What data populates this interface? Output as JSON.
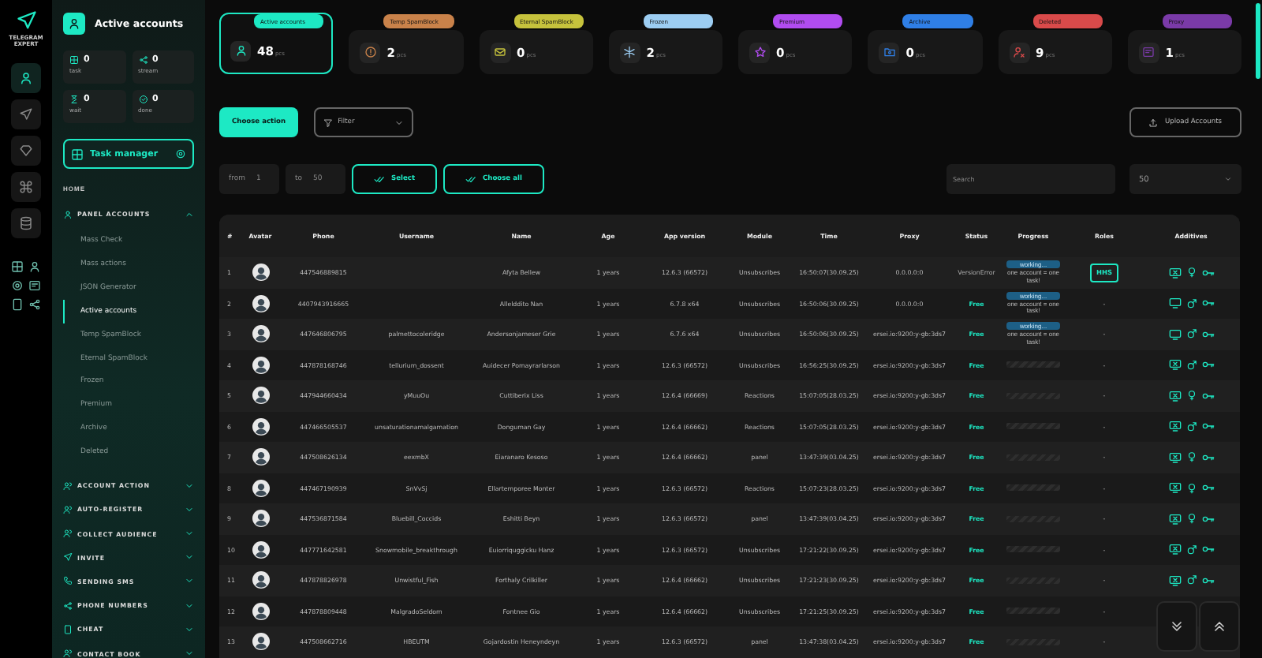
{
  "app": {
    "logo_text": "TELEGRAM EXPERT"
  },
  "rail": [
    {
      "kind": "user",
      "selected": true
    },
    {
      "kind": "send",
      "selected": false
    },
    {
      "kind": "diamond",
      "selected": false
    },
    {
      "kind": "command",
      "selected": false
    },
    {
      "kind": "database",
      "selected": false
    }
  ],
  "sidebar": {
    "title": "Active accounts",
    "stats": [
      {
        "kind": "task",
        "value": "0",
        "label": "task"
      },
      {
        "kind": "stream",
        "value": "0",
        "label": "stream"
      },
      {
        "kind": "wait",
        "value": "0",
        "label": "wait"
      },
      {
        "kind": "done",
        "value": "0",
        "label": "done"
      }
    ],
    "task_manager": "Task manager",
    "nav": [
      {
        "kind": "link",
        "label": "HOME"
      },
      {
        "kind": "group",
        "label": "PANEL ACCOUNTS",
        "expanded": true,
        "children": [
          {
            "label": "Mass Check",
            "selected": false
          },
          {
            "label": "Mass actions",
            "selected": false
          },
          {
            "label": "JSON Generator",
            "selected": false
          },
          {
            "label": "Active accounts",
            "selected": true
          },
          {
            "label": "Temp SpamBlock",
            "selected": false
          },
          {
            "label": "Eternal SpamBlock",
            "selected": false
          },
          {
            "label": "Frozen",
            "selected": false
          },
          {
            "label": "Premium",
            "selected": false
          },
          {
            "label": "Archive",
            "selected": false
          },
          {
            "label": "Deleted",
            "selected": false
          }
        ]
      },
      {
        "kind": "group",
        "label": "ACCOUNT ACTION",
        "expanded": false
      },
      {
        "kind": "group",
        "label": "AUTO-REGISTER",
        "expanded": false
      },
      {
        "kind": "group",
        "label": "COLLECT AUDIENCE",
        "expanded": false
      },
      {
        "kind": "group",
        "label": "INVITE",
        "expanded": false
      },
      {
        "kind": "group",
        "label": "SENDING SMS",
        "expanded": false
      },
      {
        "kind": "group",
        "label": "PHONE NUMBERS",
        "expanded": false
      },
      {
        "kind": "group",
        "label": "CHEAT",
        "expanded": false
      },
      {
        "kind": "group",
        "label": "CONTACT BOOK",
        "expanded": false
      }
    ]
  },
  "cards": [
    {
      "kind": "active",
      "label": "Active accounts",
      "count": "48",
      "unit": "pcs",
      "color": "#1de9c4",
      "selected": true
    },
    {
      "kind": "temp",
      "label": "Temp SpamBlock",
      "count": "2",
      "unit": "pcs",
      "color": "#c9824a",
      "selected": false
    },
    {
      "kind": "eternal",
      "label": "Eternal SpamBlock",
      "count": "0",
      "unit": "pcs",
      "color": "#c6c23c",
      "selected": false
    },
    {
      "kind": "frozen",
      "label": "Frozen",
      "count": "2",
      "unit": "pcs",
      "color": "#9ccdf2",
      "selected": false
    },
    {
      "kind": "premium",
      "label": "Premium",
      "count": "0",
      "unit": "pcs",
      "color": "#b14cf0",
      "selected": false
    },
    {
      "kind": "archive",
      "label": "Archive",
      "count": "0",
      "unit": "pcs",
      "color": "#2f7fe6",
      "selected": false
    },
    {
      "kind": "deleted",
      "label": "Deleted",
      "count": "9",
      "unit": "pcs",
      "color": "#d94a4a",
      "selected": false
    },
    {
      "kind": "proxy",
      "label": "Proxy",
      "count": "1",
      "unit": "pcs",
      "color": "#7a3aa8",
      "selected": false
    }
  ],
  "toolbar": {
    "choose_action": "Choose action",
    "filter": "Filter",
    "upload": "Upload Accounts"
  },
  "range": {
    "from_label": "from",
    "from_value": "1",
    "to_label": "to",
    "to_value": "50",
    "select": "Select",
    "choose_all": "Choose all",
    "search_placeholder": "Search",
    "page_size": "50"
  },
  "table": {
    "columns": [
      "#",
      "Avatar",
      "Phone",
      "Username",
      "Name",
      "Age",
      "App version",
      "Module",
      "Time",
      "Proxy",
      "Status",
      "Progress",
      "Roles",
      "Additives"
    ],
    "rows": [
      {
        "n": "1",
        "phone": "447546889815",
        "username": "",
        "name": "Afyta Bellew",
        "age": "1 years",
        "app": "12.6.3 (66572)",
        "module": "Unsubscribes",
        "time": "16:50:07(30.09.25)",
        "proxy": "0.0.0.0:0",
        "status": "VersionError",
        "status_ok": false,
        "progress": {
          "kind": "working",
          "badge": "working...",
          "note": "one account = one task!"
        },
        "role": "HHS",
        "female": true,
        "screen_crossed": true
      },
      {
        "n": "2",
        "phone": "4407943916665",
        "username": "",
        "name": "Allelddito Nan",
        "age": "1 years",
        "app": "6.7.8 x64",
        "module": "Unsubscribes",
        "time": "16:50:06(30.09.25)",
        "proxy": "0.0.0.0:0",
        "status": "Free",
        "status_ok": true,
        "progress": {
          "kind": "working",
          "badge": "working...",
          "note": "one account = one task!"
        },
        "role": "-",
        "female": false,
        "screen_crossed": false
      },
      {
        "n": "3",
        "phone": "447646806795",
        "username": "palmettocoleridge",
        "name": "Andersonjameser Grie",
        "age": "1 years",
        "app": "6.7.6 x64",
        "module": "Unsubscribes",
        "time": "16:50:06(30.09.25)",
        "proxy": "ersei.io:9200:y-gb:3ds7",
        "status": "Free",
        "status_ok": true,
        "progress": {
          "kind": "working",
          "badge": "working...",
          "note": "one account = one task!"
        },
        "role": "-",
        "female": false,
        "screen_crossed": false
      },
      {
        "n": "4",
        "phone": "447878168746",
        "username": "tellurium_dossent",
        "name": "Auidecer Pomayrarlarson",
        "age": "1 years",
        "app": "12.6.3 (66572)",
        "module": "Unsubscribes",
        "time": "16:56:25(30.09.25)",
        "proxy": "ersei.io:9200:y-gb:3ds7",
        "status": "Free",
        "status_ok": true,
        "progress": {
          "kind": "idle",
          "level": 0
        },
        "role": "-",
        "female": false,
        "screen_crossed": true
      },
      {
        "n": "5",
        "phone": "447944660434",
        "username": "yMuuOu",
        "name": "Cuttiberix Liss",
        "age": "1 years",
        "app": "12.6.4 (66669)",
        "module": "Reactions",
        "time": "15:07:05(28.03.25)",
        "proxy": "ersei.io:9200:y-gb:3ds7",
        "status": "Free",
        "status_ok": true,
        "progress": {
          "kind": "idle",
          "level": 0
        },
        "role": "-",
        "female": true,
        "screen_crossed": true
      },
      {
        "n": "6",
        "phone": "447466505537",
        "username": "unsaturationamalgamation",
        "name": "Donguman Gay",
        "age": "1 years",
        "app": "12.6.4 (66662)",
        "module": "Reactions",
        "time": "15:07:05(28.03.25)",
        "proxy": "ersei.io:9200:y-gb:3ds7",
        "status": "Free",
        "status_ok": true,
        "progress": {
          "kind": "idle",
          "level": 0
        },
        "role": "-",
        "female": false,
        "screen_crossed": true
      },
      {
        "n": "7",
        "phone": "447508626134",
        "username": "eexmbX",
        "name": "Eiaranaro Kesoso",
        "age": "1 years",
        "app": "12.6.4 (66662)",
        "module": "panel",
        "time": "13:47:39(03.04.25)",
        "proxy": "ersei.io:9200:y-gb:3ds7",
        "status": "Free",
        "status_ok": true,
        "progress": {
          "kind": "idle",
          "level": 0
        },
        "role": "-",
        "female": true,
        "screen_crossed": true
      },
      {
        "n": "8",
        "phone": "447467190939",
        "username": "SnVvSj",
        "name": "Ellartemporee Monter",
        "age": "1 years",
        "app": "12.6.3 (66572)",
        "module": "Reactions",
        "time": "15:07:23(28.03.25)",
        "proxy": "ersei.io:9200:y-gb:3ds7",
        "status": "Free",
        "status_ok": true,
        "progress": {
          "kind": "idle",
          "level": 0
        },
        "role": "-",
        "female": true,
        "screen_crossed": true
      },
      {
        "n": "9",
        "phone": "447536871584",
        "username": "Bluebill_Coccids",
        "name": "Eshitti Beyn",
        "age": "1 years",
        "app": "12.6.3 (66572)",
        "module": "panel",
        "time": "13:47:39(03.04.25)",
        "proxy": "ersei.io:9200:y-gb:3ds7",
        "status": "Free",
        "status_ok": true,
        "progress": {
          "kind": "idle",
          "level": 0
        },
        "role": "-",
        "female": true,
        "screen_crossed": true
      },
      {
        "n": "10",
        "phone": "447771642581",
        "username": "Snowmobile_breakthrough",
        "name": "Euiorriquggicku Hanz",
        "age": "1 years",
        "app": "12.6.3 (66572)",
        "module": "Unsubscribes",
        "time": "17:21:22(30.09.25)",
        "proxy": "ersei.io:9200:y-gb:3ds7",
        "status": "Free",
        "status_ok": true,
        "progress": {
          "kind": "idle",
          "level": 0
        },
        "role": "-",
        "female": false,
        "screen_crossed": true
      },
      {
        "n": "11",
        "phone": "447878826978",
        "username": "Unwistful_Fish",
        "name": "Forthaly Crilkiller",
        "age": "1 years",
        "app": "12.6.4 (66662)",
        "module": "Unsubscribes",
        "time": "17:21:23(30.09.25)",
        "proxy": "ersei.io:9200:y-gb:3ds7",
        "status": "Free",
        "status_ok": true,
        "progress": {
          "kind": "idle",
          "level": 0
        },
        "role": "-",
        "female": false,
        "screen_crossed": true
      },
      {
        "n": "12",
        "phone": "447878809448",
        "username": "MalgradoSeldom",
        "name": "Fontnee Gio",
        "age": "1 years",
        "app": "12.6.4 (66662)",
        "module": "Unsubscribes",
        "time": "17:21:25(30.09.25)",
        "proxy": "ersei.io:9200:y-gb:3ds7",
        "status": "Free",
        "status_ok": true,
        "progress": {
          "kind": "idle",
          "level": 0
        },
        "role": "-"
      },
      {
        "n": "13",
        "phone": "447508662716",
        "username": "HBEUTM",
        "name": "Gojardostin Heneyndeyn",
        "age": "1 years",
        "app": "12.6.3 (66572)",
        "module": "panel",
        "time": "13:47:38(03.04.25)",
        "proxy": "ersei.io:9200:y-gb:3ds7",
        "status": "Free",
        "status_ok": true,
        "progress": {
          "kind": "idle",
          "level": 0
        },
        "role": "-"
      }
    ]
  }
}
